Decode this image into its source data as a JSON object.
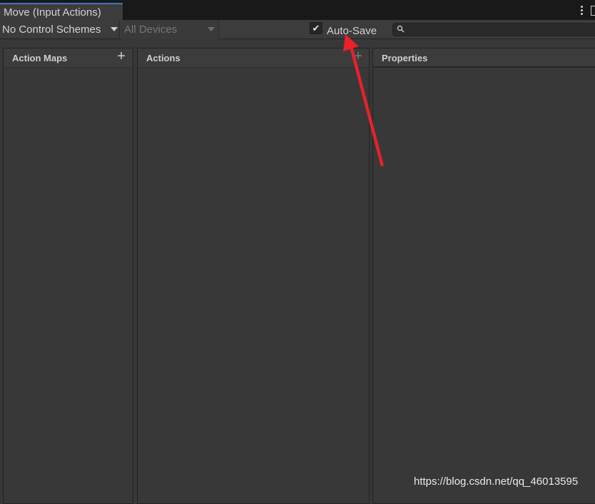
{
  "window": {
    "tab_title": "Move (Input Actions)"
  },
  "toolbar": {
    "control_scheme": "No Control Schemes",
    "devices": "All Devices",
    "autosave_checked": true,
    "autosave_label": "Auto-Save",
    "search_value": ""
  },
  "panels": {
    "action_maps": {
      "title": "Action Maps"
    },
    "actions": {
      "title": "Actions"
    },
    "properties": {
      "title": "Properties"
    }
  },
  "icons": {
    "menu": "kebab-menu-icon",
    "maximize": "maximize-icon",
    "dropdown": "chevron-down-icon",
    "check": "checkmark-icon",
    "search": "search-icon",
    "add": "plus-icon",
    "annotation": "arrow-icon"
  },
  "colors": {
    "accent_tab": "#3a79bb",
    "annotation_arrow": "#e8212a",
    "background": "#383838"
  },
  "watermark": "https://blog.csdn.net/qq_46013595"
}
